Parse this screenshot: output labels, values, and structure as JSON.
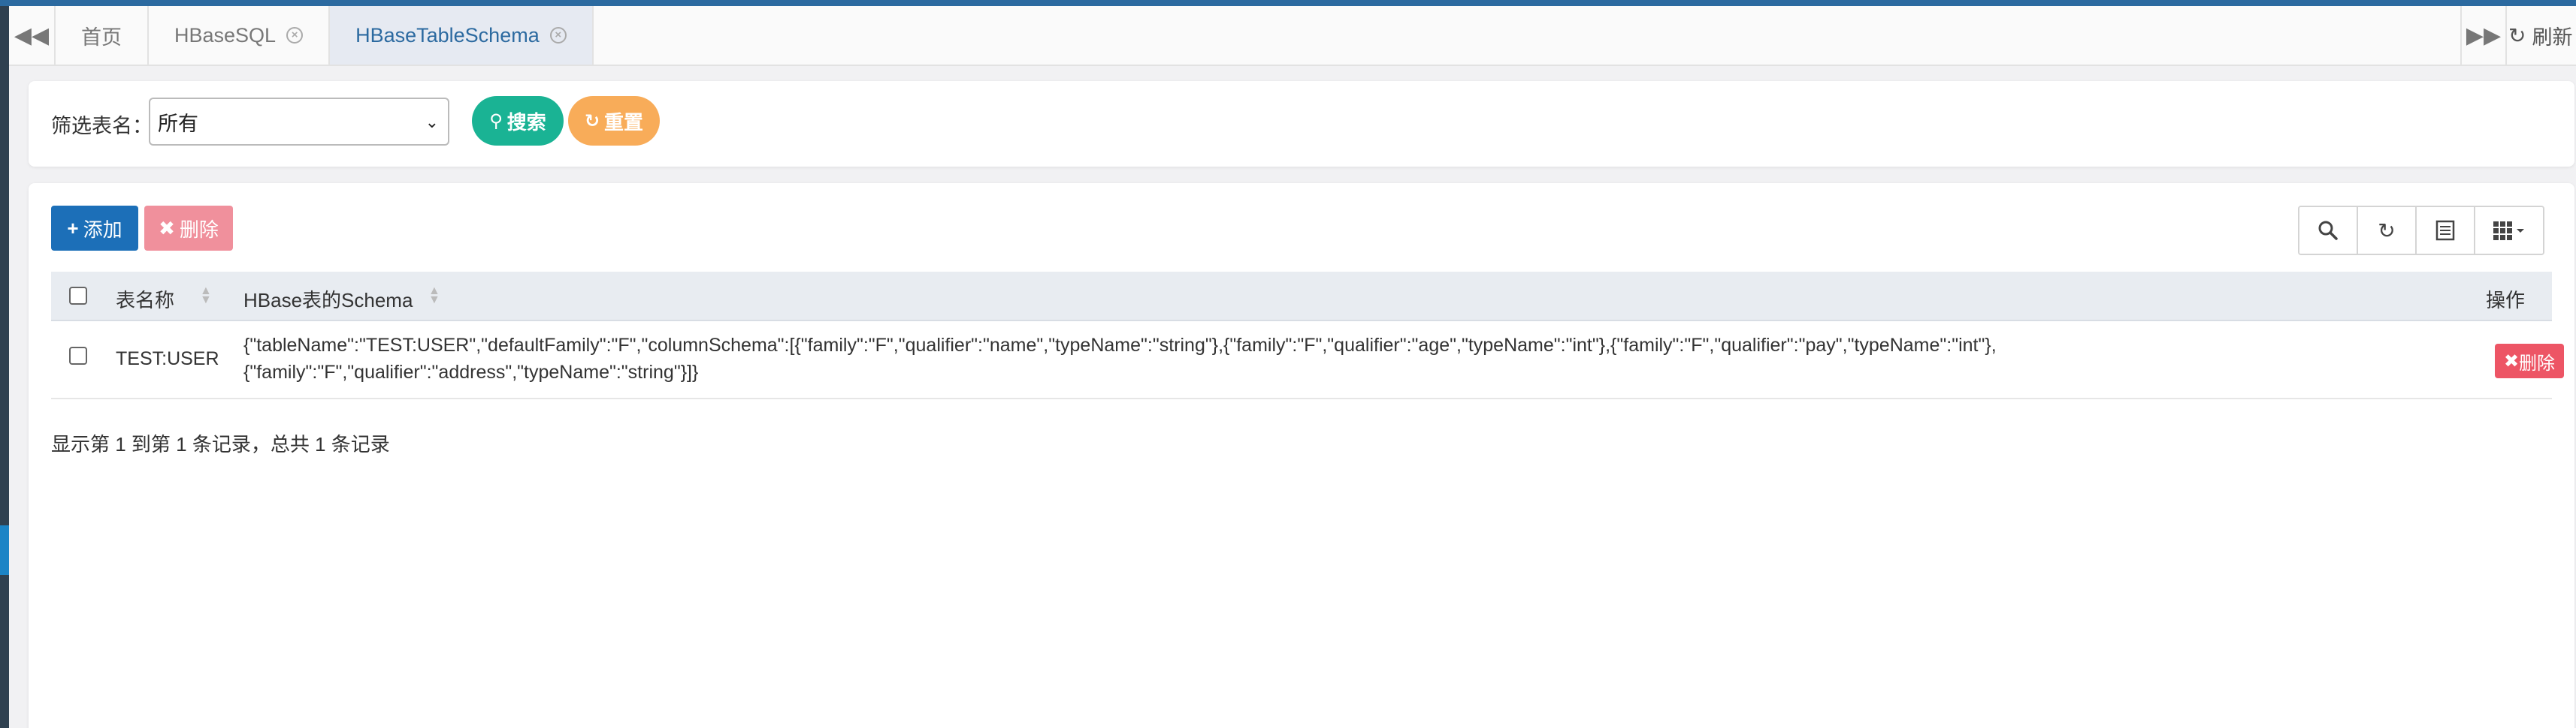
{
  "tabs": {
    "items": [
      {
        "label": "首页",
        "closable": false,
        "active": false
      },
      {
        "label": "HBaseSQL",
        "closable": true,
        "active": false
      },
      {
        "label": "HBaseTableSchema",
        "closable": true,
        "active": true
      }
    ],
    "refresh_label": "刷新"
  },
  "filter": {
    "label": "筛选表名：",
    "select_value": "所有",
    "search_label": "搜索",
    "reset_label": "重置"
  },
  "toolbar": {
    "add_label": "添加",
    "delete_label": "删除"
  },
  "table": {
    "columns": [
      "表名称",
      "HBase表的Schema",
      "操作"
    ],
    "rows": [
      {
        "table_name": "TEST:USER",
        "schema_line1": "{\"tableName\":\"TEST:USER\",\"defaultFamily\":\"F\",\"columnSchema\":[{\"family\":\"F\",\"qualifier\":\"name\",\"typeName\":\"string\"},{\"family\":\"F\",\"qualifier\":\"age\",\"typeName\":\"int\"},{\"family\":\"F\",\"qualifier\":\"pay\",\"typeName\":\"int\"},",
        "schema_line2": "{\"family\":\"F\",\"qualifier\":\"address\",\"typeName\":\"string\"}]}",
        "action_label": "删除"
      }
    ]
  },
  "pagination": {
    "info": "显示第 1 到第 1 条记录，总共 1 条记录"
  },
  "colors": {
    "accent": "#2c6aa0",
    "search": "#1ab394",
    "reset": "#f8ac59",
    "add": "#1c6fb8",
    "delete_disabled": "#f0909c",
    "delete": "#ed5565"
  }
}
